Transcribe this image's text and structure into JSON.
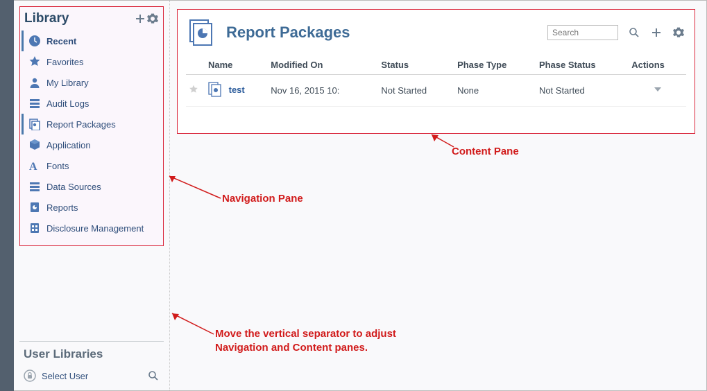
{
  "sidebar": {
    "title": "Library",
    "items": [
      {
        "label": "Recent",
        "icon": "clock"
      },
      {
        "label": "Favorites",
        "icon": "star"
      },
      {
        "label": "My Library",
        "icon": "person"
      },
      {
        "label": "Audit Logs",
        "icon": "rows"
      },
      {
        "label": "Report Packages",
        "icon": "stack"
      },
      {
        "label": "Application",
        "icon": "cube"
      },
      {
        "label": "Fonts",
        "icon": "font"
      },
      {
        "label": "Data Sources",
        "icon": "rows"
      },
      {
        "label": "Reports",
        "icon": "page-pie"
      },
      {
        "label": "Disclosure Management",
        "icon": "page-grid"
      }
    ]
  },
  "user_libraries": {
    "title": "User Libraries",
    "select_label": "Select User"
  },
  "content": {
    "title": "Report Packages",
    "search_placeholder": "Search",
    "columns": {
      "name": "Name",
      "modified": "Modified On",
      "status": "Status",
      "phase_type": "Phase Type",
      "phase_status": "Phase Status",
      "actions": "Actions"
    },
    "rows": [
      {
        "name": "test",
        "modified": "Nov 16, 2015 10:",
        "status": "Not Started",
        "phase_type": "None",
        "phase_status": "Not Started"
      }
    ]
  },
  "annotations": {
    "nav": "Navigation Pane",
    "content": "Content Pane",
    "separator": "Move the vertical separator to adjust Navigation and Content panes."
  }
}
